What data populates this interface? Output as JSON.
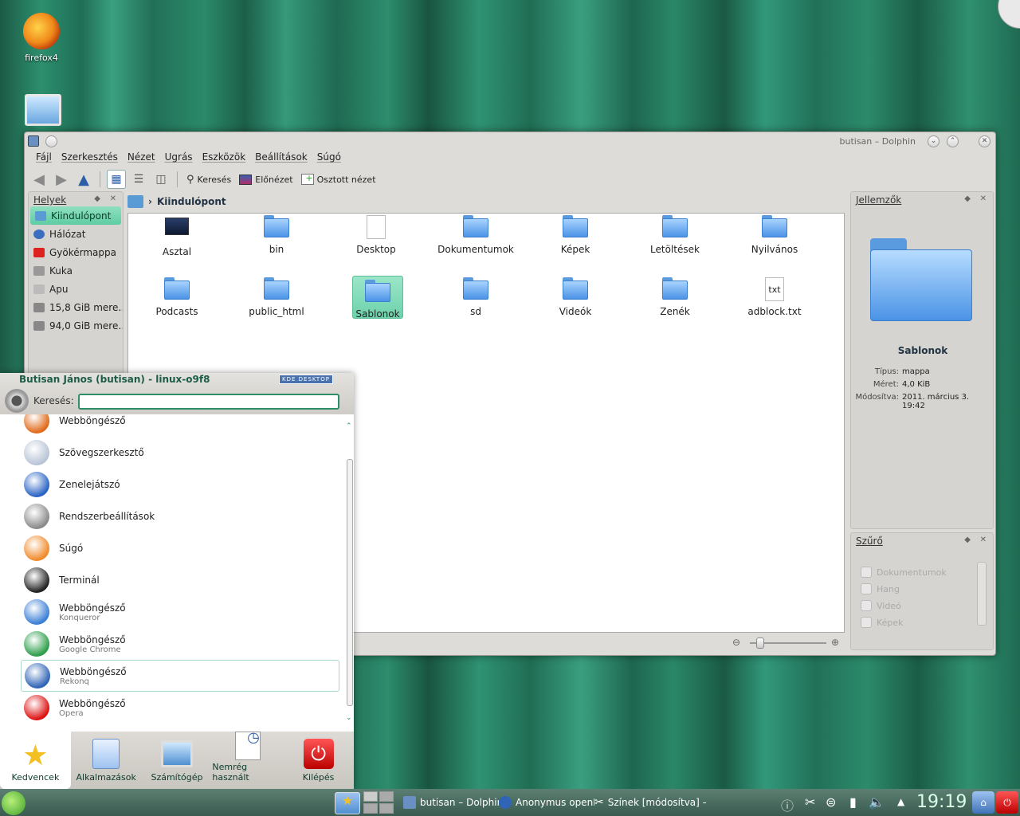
{
  "desktop": {
    "firefox_label": "firefox4"
  },
  "dolphin": {
    "window_title": "butisan – Dolphin",
    "menus": [
      "Fájl",
      "Szerkesztés",
      "Nézet",
      "Ugrás",
      "Eszközök",
      "Beállítások",
      "Súgó"
    ],
    "toolbar": {
      "search": "Keresés",
      "preview": "Előnézet",
      "split": "Osztott nézet"
    },
    "places": {
      "title": "Helyek",
      "items": [
        {
          "label": "Kiindulópont",
          "color": "#5b9bd5"
        },
        {
          "label": "Hálózat",
          "color": "#3a6fc0"
        },
        {
          "label": "Gyökérmappa",
          "color": "#d22"
        },
        {
          "label": "Kuka",
          "color": "#999"
        },
        {
          "label": "Apu",
          "color": "#bbb"
        },
        {
          "label": "15,8 GiB mere…",
          "color": "#888"
        },
        {
          "label": "94,0 GiB mere…",
          "color": "#888"
        }
      ]
    },
    "breadcrumb": "Kiindulópont",
    "files": [
      {
        "name": "Asztal",
        "kind": "desktop"
      },
      {
        "name": "bin",
        "kind": "folder"
      },
      {
        "name": "Desktop",
        "kind": "file"
      },
      {
        "name": "Dokumentumok",
        "kind": "docfolder"
      },
      {
        "name": "Képek",
        "kind": "folder"
      },
      {
        "name": "Letöltések",
        "kind": "folder"
      },
      {
        "name": "Nyilvános",
        "kind": "folder"
      },
      {
        "name": "Podcasts",
        "kind": "folder"
      },
      {
        "name": "public_html",
        "kind": "webfolder"
      },
      {
        "name": "Sablonok",
        "kind": "folder"
      },
      {
        "name": "sd",
        "kind": "folder"
      },
      {
        "name": "Videók",
        "kind": "folder"
      },
      {
        "name": "Zenék",
        "kind": "folder"
      },
      {
        "name": "adblock.txt",
        "kind": "txt"
      }
    ],
    "selected_file": "Sablonok",
    "info": {
      "title": "Jellemzők",
      "name": "Sablonok",
      "type_label": "Típus:",
      "type_value": "mappa",
      "size_label": "Méret:",
      "size_value": "4,0 KiB",
      "modified_label": "Módosítva:",
      "modified_value": "2011. március 3. 19:42"
    },
    "filter": {
      "title": "Szűrő",
      "options": [
        "Dokumentumok",
        "Hang",
        "Videó",
        "Képek"
      ]
    }
  },
  "kickoff": {
    "user": "Butisan János (butisan) - linux-o9f8",
    "badge": "KDE DESKTOP",
    "search_label": "Keresés:",
    "search_value": "",
    "items": [
      {
        "title": "Webböngésző",
        "sub": "",
        "color": "#e06a1a"
      },
      {
        "title": "Szövegszerkesztő",
        "sub": "",
        "color": "#b8c4d6"
      },
      {
        "title": "Zenelejátszó",
        "sub": "",
        "color": "#2a63c4"
      },
      {
        "title": "Rendszerbeállítások",
        "sub": "",
        "color": "#8a8a8a"
      },
      {
        "title": "Súgó",
        "sub": "",
        "color": "#f08a2a"
      },
      {
        "title": "Terminál",
        "sub": "",
        "color": "#222"
      },
      {
        "title": "Webböngésző",
        "sub": "Konqueror",
        "color": "#3b7fd6"
      },
      {
        "title": "Webböngésző",
        "sub": "Google Chrome",
        "color": "#2d9e4a"
      },
      {
        "title": "Webböngésző",
        "sub": "Rekonq",
        "color": "#2f64b6"
      },
      {
        "title": "Webböngésző",
        "sub": "Opera",
        "color": "#d11"
      }
    ],
    "tabs": [
      "Kedvencek",
      "Alkalmazások",
      "Számítógép",
      "Nemrég használt",
      "Kilépés"
    ]
  },
  "taskbar": {
    "tasks": [
      "butisan – Dolphin",
      "Anonymus openD…",
      "Színek [módosítva] –"
    ],
    "clock": "19:19"
  }
}
